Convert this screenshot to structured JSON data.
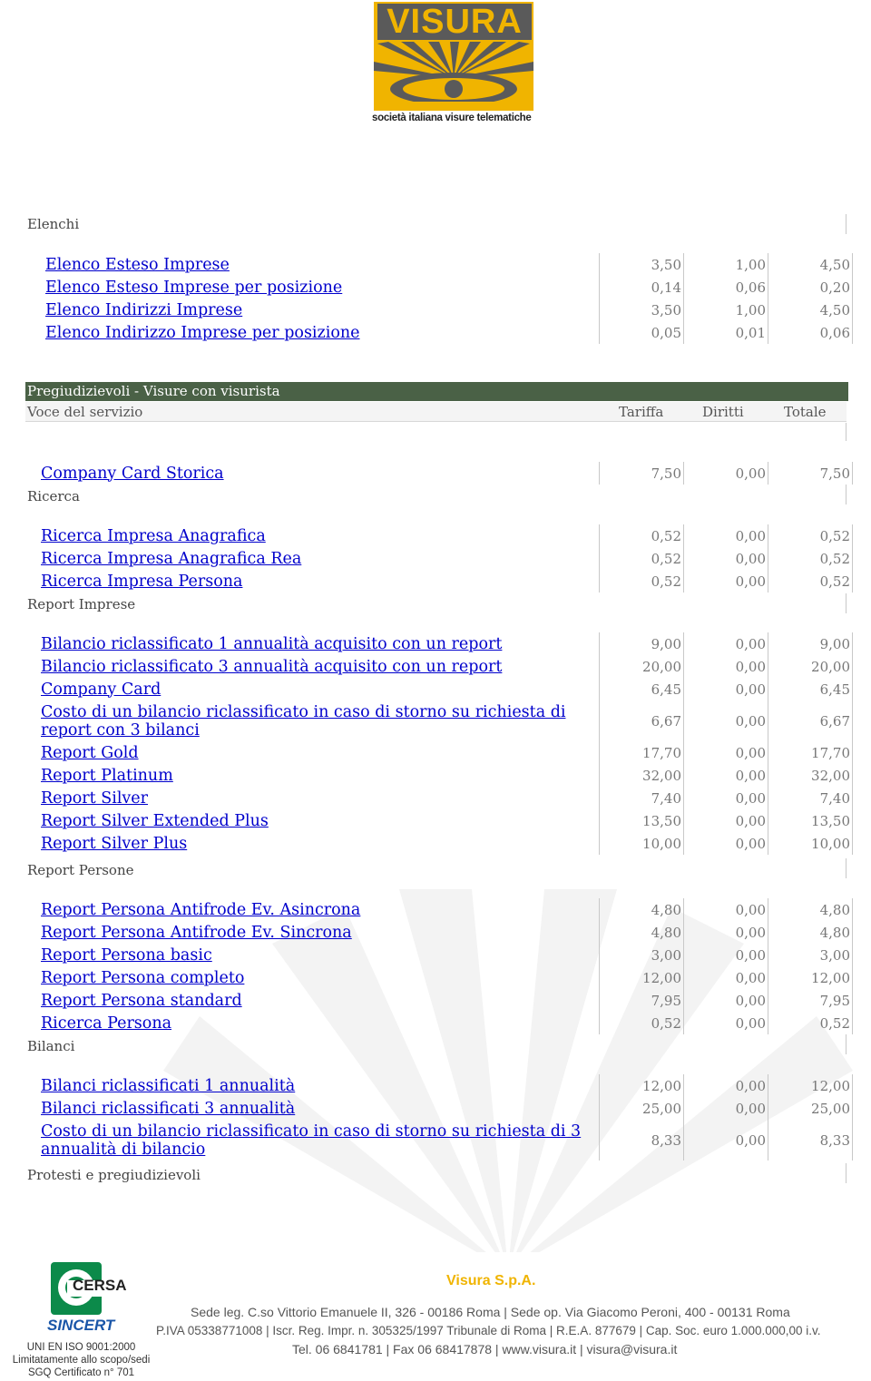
{
  "logo": {
    "name": "VISURA",
    "tagline": "società italiana visure telematiche"
  },
  "elenchi": {
    "heading": "Elenchi",
    "rows": [
      {
        "name": "Elenco Esteso Imprese",
        "tariffa": "3,50",
        "diritti": "1,00",
        "totale": "4,50"
      },
      {
        "name": "Elenco Esteso Imprese per posizione",
        "tariffa": "0,14",
        "diritti": "0,06",
        "totale": "0,20"
      },
      {
        "name": "Elenco Indirizzi Imprese",
        "tariffa": "3,50",
        "diritti": "1,00",
        "totale": "4,50"
      },
      {
        "name": "Elenco Indirizzo Imprese per posizione",
        "tariffa": "0,05",
        "diritti": "0,01",
        "totale": "0,06"
      }
    ]
  },
  "section": {
    "title": "Pregiudizievoli - Visure con visurista",
    "col_voce": "Voce del servizio",
    "col_tariffa": "Tariffa",
    "col_diritti": "Diritti",
    "col_totale": "Totale"
  },
  "group0": {
    "rows": [
      {
        "name": "Company Card Storica",
        "tariffa": "7,50",
        "diritti": "0,00",
        "totale": "7,50"
      }
    ]
  },
  "ricerca": {
    "heading": "Ricerca",
    "rows": [
      {
        "name": "Ricerca Impresa Anagrafica",
        "tariffa": "0,52",
        "diritti": "0,00",
        "totale": "0,52"
      },
      {
        "name": "Ricerca Impresa Anagrafica Rea",
        "tariffa": "0,52",
        "diritti": "0,00",
        "totale": "0,52"
      },
      {
        "name": "Ricerca Impresa Persona",
        "tariffa": "0,52",
        "diritti": "0,00",
        "totale": "0,52"
      }
    ]
  },
  "report_imprese": {
    "heading": "Report Imprese",
    "rows": [
      {
        "name": "Bilancio riclassificato 1 annualità acquisito con un report",
        "tariffa": "9,00",
        "diritti": "0,00",
        "totale": "9,00"
      },
      {
        "name": "Bilancio riclassificato 3 annualità acquisito con un report",
        "tariffa": "20,00",
        "diritti": "0,00",
        "totale": "20,00"
      },
      {
        "name": "Company Card",
        "tariffa": "6,45",
        "diritti": "0,00",
        "totale": "6,45"
      },
      {
        "name": "Costo di un bilancio riclassificato in caso di storno su richiesta di report con 3 bilanci",
        "tariffa": "6,67",
        "diritti": "0,00",
        "totale": "6,67"
      },
      {
        "name": "Report Gold",
        "tariffa": "17,70",
        "diritti": "0,00",
        "totale": "17,70"
      },
      {
        "name": "Report Platinum",
        "tariffa": "32,00",
        "diritti": "0,00",
        "totale": "32,00"
      },
      {
        "name": "Report Silver",
        "tariffa": "7,40",
        "diritti": "0,00",
        "totale": "7,40"
      },
      {
        "name": "Report Silver Extended Plus",
        "tariffa": "13,50",
        "diritti": "0,00",
        "totale": "13,50"
      },
      {
        "name": "Report Silver Plus",
        "tariffa": "10,00",
        "diritti": "0,00",
        "totale": "10,00"
      }
    ]
  },
  "report_persone": {
    "heading": "Report Persone",
    "rows": [
      {
        "name": "Report Persona Antifrode Ev. Asincrona",
        "tariffa": "4,80",
        "diritti": "0,00",
        "totale": "4,80"
      },
      {
        "name": "Report Persona Antifrode Ev. Sincrona",
        "tariffa": "4,80",
        "diritti": "0,00",
        "totale": "4,80"
      },
      {
        "name": "Report Persona basic",
        "tariffa": "3,00",
        "diritti": "0,00",
        "totale": "3,00"
      },
      {
        "name": "Report Persona completo",
        "tariffa": "12,00",
        "diritti": "0,00",
        "totale": "12,00"
      },
      {
        "name": "Report Persona standard",
        "tariffa": "7,95",
        "diritti": "0,00",
        "totale": "7,95"
      },
      {
        "name": "Ricerca Persona",
        "tariffa": "0,52",
        "diritti": "0,00",
        "totale": "0,52"
      }
    ]
  },
  "bilanci": {
    "heading": "Bilanci",
    "rows": [
      {
        "name": "Bilanci riclassificati 1 annualità",
        "tariffa": "12,00",
        "diritti": "0,00",
        "totale": "12,00"
      },
      {
        "name": "Bilanci riclassificati 3 annualità",
        "tariffa": "25,00",
        "diritti": "0,00",
        "totale": "25,00"
      },
      {
        "name": "Costo di un bilancio riclassificato in caso di storno su richiesta di 3 annualità di bilancio",
        "tariffa": "8,33",
        "diritti": "0,00",
        "totale": "8,33"
      }
    ]
  },
  "protesti": {
    "heading": "Protesti e pregiudizievoli"
  },
  "footer": {
    "company": "Visura S.p.A.",
    "line1": "Sede leg. C.so Vittorio Emanuele II, 326 - 00186 Roma | Sede op. Via Giacomo Peroni, 400 - 00131 Roma",
    "line2": "P.IVA 05338771008 | Iscr. Reg. Impr. n. 305325/1997 Tribunale di Roma | R.E.A. 877679 | Cap. Soc. euro 1.000.000,00 i.v.",
    "line3": "Tel. 06 6841781 | Fax 06 68417878 | www.visura.it | visura@visura.it",
    "cert_brand1": "CERSA",
    "cert_brand2": "SINCERT",
    "cert_line1": "UNI EN ISO 9001:2000",
    "cert_line2": "Limitatamente allo scopo/sedi",
    "cert_line3": "SGQ Certificato n° 701"
  }
}
